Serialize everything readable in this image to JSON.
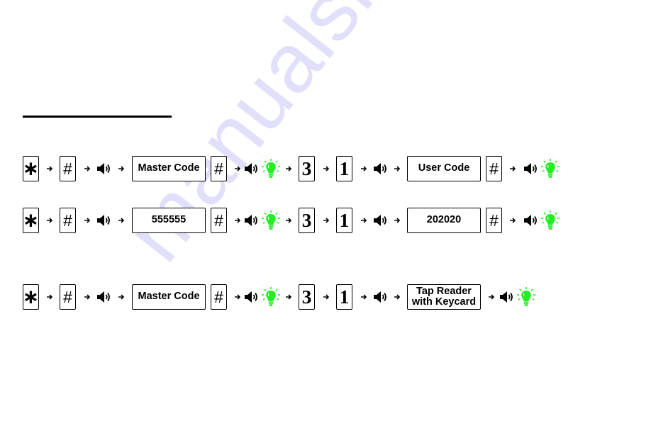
{
  "document": {
    "heading_underline": true,
    "watermark": "manualshive."
  },
  "colors": {
    "ink": "#000000",
    "bulb_green": "#22ee22",
    "watermark": "#786ee6"
  },
  "icons": {
    "arrow": "right-arrow-icon",
    "speaker": "speaker-beep-icon",
    "bulb": "green-light-bulb-icon"
  },
  "sequences": [
    {
      "name": "add-user-code-template",
      "keys": {
        "star": "∗",
        "hash1": "#",
        "code": "Master Code",
        "hash2": "#",
        "digit1": "3",
        "digit2": "1",
        "entry": "User Code",
        "hash3": "#"
      }
    },
    {
      "name": "add-user-code-example",
      "keys": {
        "star": "∗",
        "hash1": "#",
        "code": "555555",
        "hash2": "#",
        "digit1": "3",
        "digit2": "1",
        "entry": "202020",
        "hash3": "#"
      }
    },
    {
      "name": "add-keycard",
      "keys": {
        "star": "∗",
        "hash1": "#",
        "code": "Master Code",
        "hash2": "#",
        "digit1": "3",
        "digit2": "1",
        "entry_line1": "Tap Reader",
        "entry_line2": "with Keycard"
      }
    }
  ]
}
